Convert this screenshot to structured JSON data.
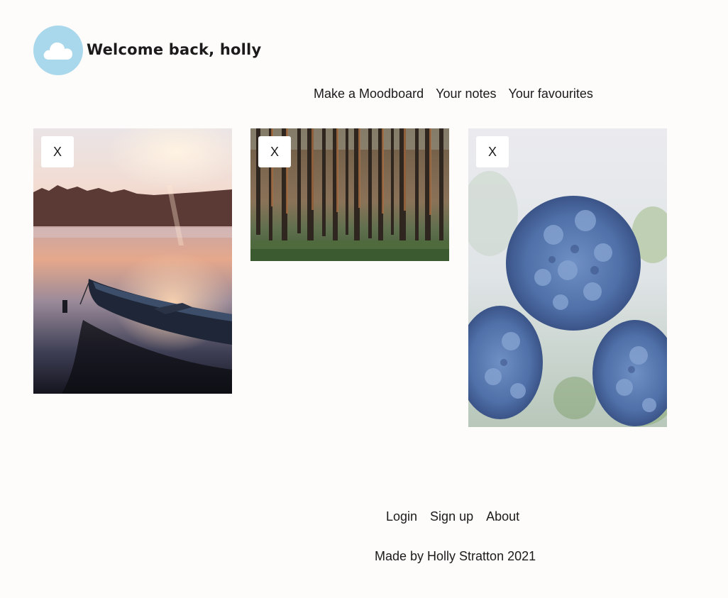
{
  "header": {
    "logo_icon": "cloud-icon",
    "welcome": "Welcome back, holly"
  },
  "nav": {
    "items": [
      "Make a Moodboard",
      "Your notes",
      "Your favourites"
    ]
  },
  "cards": [
    {
      "image": "lake-sunrise-boat-photo",
      "close_label": "X"
    },
    {
      "image": "pine-forest-photo",
      "close_label": "X"
    },
    {
      "image": "blue-hydrangea-photo",
      "close_label": "X"
    }
  ],
  "footer": {
    "links": [
      "Login",
      "Sign up",
      "About"
    ],
    "credit": "Made by Holly Stratton 2021"
  },
  "colors": {
    "background": "#fdfcfa",
    "logo_circle": "#a9d8ec",
    "text": "#1b1b1b"
  }
}
